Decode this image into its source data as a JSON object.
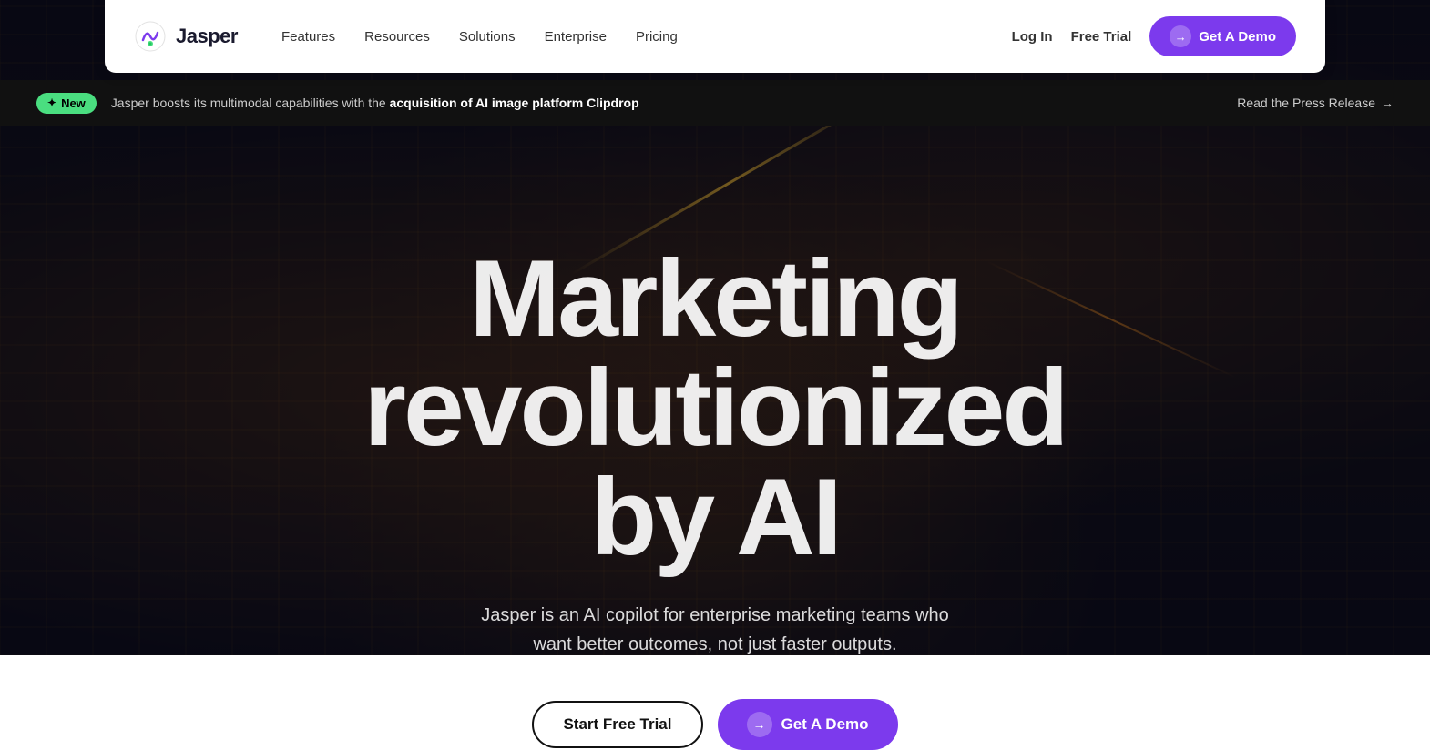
{
  "navbar": {
    "logo_text": "Jasper",
    "nav_links": [
      {
        "label": "Features",
        "id": "features"
      },
      {
        "label": "Resources",
        "id": "resources"
      },
      {
        "label": "Solutions",
        "id": "solutions"
      },
      {
        "label": "Enterprise",
        "id": "enterprise"
      },
      {
        "label": "Pricing",
        "id": "pricing"
      }
    ],
    "login_label": "Log In",
    "free_trial_label": "Free Trial",
    "demo_btn_label": "Get A Demo"
  },
  "announcement": {
    "badge_label": "New",
    "badge_star": "✦",
    "text_before": "Jasper boosts its multimodal capabilities with the ",
    "text_bold": "acquisition of AI image platform Clipdrop",
    "press_release_label": "Read the Press Release",
    "arrow": "→"
  },
  "hero": {
    "headline_line1": "Marketing",
    "headline_line2": "revolutionized by AI",
    "subheadline": "Jasper is an AI copilot for enterprise marketing teams who want better outcomes, not just faster outputs.",
    "cta_trial_label": "Start Free Trial",
    "cta_demo_label": "Get A Demo",
    "demo_arrow": "→"
  }
}
